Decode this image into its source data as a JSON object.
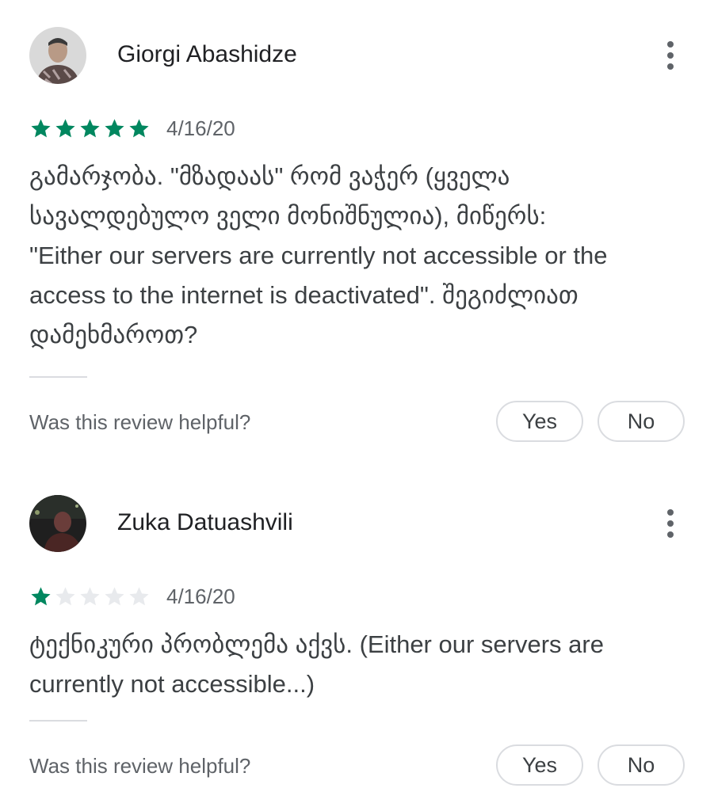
{
  "colors": {
    "star_filled": "#01875f",
    "star_empty": "#e8eaed",
    "text_primary": "#202124",
    "text_secondary": "#5f6368",
    "divider": "#dadce0"
  },
  "reviews": [
    {
      "author": "Giorgi Abashidze",
      "rating": 5,
      "date": "4/16/20",
      "text_lines": [
        "გამარჯობა. \"მზადაას\" რომ ვაჭერ (ყველა",
        "სავალდებულო ველი მონიშნულია), მიწერს:",
        "\"Either our servers are currently not accessible or the",
        "access to the internet is deactivated\". შეგიძლიათ",
        "დამეხმაროთ?"
      ],
      "helpful_question": "Was this review helpful?",
      "yes_label": "Yes",
      "no_label": "No",
      "avatar_icon": "avatar-photo",
      "more_icon": "more-vert-icon"
    },
    {
      "author": "Zuka Datuashvili",
      "rating": 1,
      "date": "4/16/20",
      "text_lines": [
        "ტექნიკური პრობლემა აქვს. (Either our servers are",
        "currently not accessible...)"
      ],
      "helpful_question": "Was this review helpful?",
      "yes_label": "Yes",
      "no_label": "No",
      "avatar_icon": "avatar-photo",
      "more_icon": "more-vert-icon"
    }
  ]
}
